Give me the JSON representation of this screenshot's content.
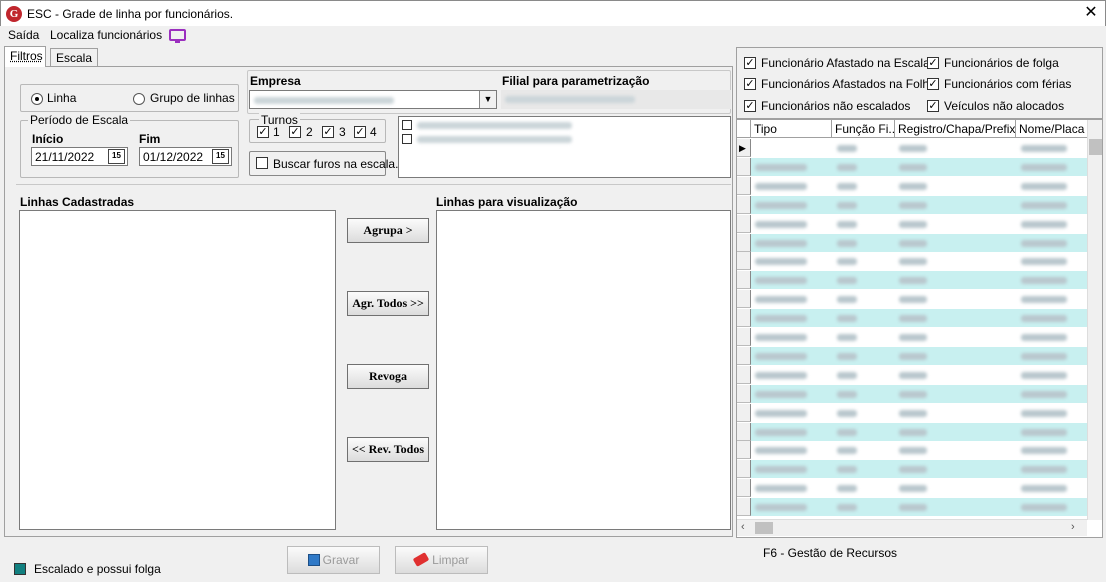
{
  "window": {
    "title": "ESC - Grade de linha por funcionários.",
    "logo_letter": "G",
    "close_glyph": "✕"
  },
  "menu": {
    "items": [
      "Saída",
      "Localiza funcionários"
    ]
  },
  "tabs": [
    {
      "label": "Filtros",
      "active": true
    },
    {
      "label": "Escala",
      "active": false
    }
  ],
  "filters": {
    "radio_linha": "Linha",
    "radio_grupo": "Grupo de linhas",
    "periodo_label": "Período de Escala",
    "inicio_label": "Início",
    "fim_label": "Fim",
    "inicio_value": "21/11/2022",
    "fim_value": "01/12/2022",
    "cal_glyph": "15",
    "empresa_label": "Empresa",
    "filial_label": "Filial para parametrização",
    "turnos_label": "Turnos",
    "turnos": [
      "1",
      "2",
      "3",
      "4"
    ],
    "buscar_label": "Buscar furos na escala."
  },
  "lists": {
    "cadastradas_label": "Linhas Cadastradas",
    "visualizacao_label": "Linhas para visualização"
  },
  "buttons": {
    "agrupa": "Agrupa >",
    "agr_todos": "Agr. Todos >>",
    "revoga": "Revoga",
    "rev_todos": "<< Rev. Todos",
    "gravar": "Gravar",
    "limpar": "Limpar"
  },
  "options": [
    {
      "label": "Funcionário Afastado na Escala",
      "checked": true
    },
    {
      "label": "Funcionários de folga",
      "checked": true
    },
    {
      "label": "Funcionários Afastados na Folha",
      "checked": true
    },
    {
      "label": "Funcionários com férias",
      "checked": true
    },
    {
      "label": "Funcionários não escalados",
      "checked": true
    },
    {
      "label": "Veículos não alocados",
      "checked": true
    }
  ],
  "grid": {
    "columns": [
      "Tipo",
      "Função Fi...",
      "Registro/Chapa/Prefixo",
      "Nome/Placa"
    ],
    "row_count": 20
  },
  "status": {
    "legend": "Escalado e possui folga",
    "legend_color": "#128080",
    "shortcut": "F6 - Gestão de Recursos"
  },
  "colors": {
    "row_alt": "#c8f0f0",
    "brand": "#c0262d",
    "tv_icon": "#9b2fbf"
  }
}
